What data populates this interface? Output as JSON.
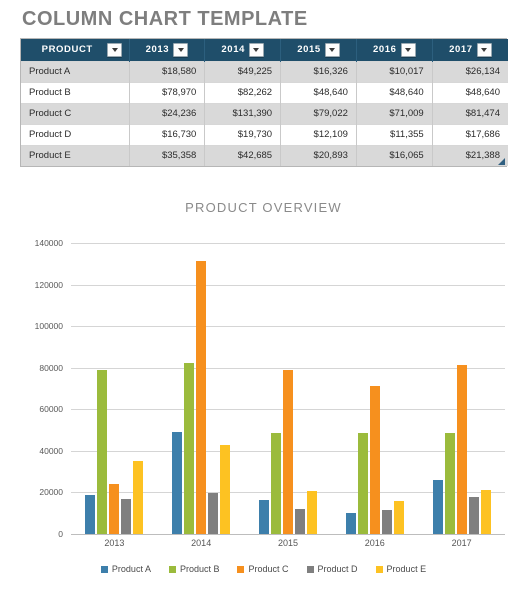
{
  "page_title": "COLUMN CHART TEMPLATE",
  "table": {
    "columns": [
      {
        "label": "PRODUCT",
        "filter_icon": "chevron-down-icon"
      },
      {
        "label": "2013",
        "filter_icon": "chevron-down-icon"
      },
      {
        "label": "2014",
        "filter_icon": "chevron-down-icon"
      },
      {
        "label": "2015",
        "filter_icon": "chevron-down-icon"
      },
      {
        "label": "2016",
        "filter_icon": "chevron-down-icon"
      },
      {
        "label": "2017",
        "filter_icon": "chevron-down-icon"
      }
    ],
    "rows": [
      {
        "product": "Product A",
        "values": [
          "$18,580",
          "$49,225",
          "$16,326",
          "$10,017",
          "$26,134"
        ]
      },
      {
        "product": "Product B",
        "values": [
          "$78,970",
          "$82,262",
          "$48,640",
          "$48,640",
          "$48,640"
        ]
      },
      {
        "product": "Product C",
        "values": [
          "$24,236",
          "$131,390",
          "$79,022",
          "$71,009",
          "$81,474"
        ]
      },
      {
        "product": "Product D",
        "values": [
          "$16,730",
          "$19,730",
          "$12,109",
          "$11,355",
          "$17,686"
        ]
      },
      {
        "product": "Product E",
        "values": [
          "$35,358",
          "$42,685",
          "$20,893",
          "$16,065",
          "$21,388"
        ]
      }
    ],
    "header_bg": "#1f4e6a",
    "stripe_bg": "#d9d9d9"
  },
  "chart_data": {
    "type": "bar",
    "title": "PRODUCT OVERVIEW",
    "xlabel": "",
    "ylabel": "",
    "categories": [
      "2013",
      "2014",
      "2015",
      "2016",
      "2017"
    ],
    "ylim": [
      0,
      140000
    ],
    "yticks": [
      0,
      20000,
      40000,
      60000,
      80000,
      100000,
      120000,
      140000
    ],
    "ytick_labels": [
      "0",
      "20000",
      "40000",
      "60000",
      "80000",
      "100000",
      "120000",
      "140000"
    ],
    "grid": true,
    "legend_position": "bottom",
    "series": [
      {
        "name": "Product A",
        "color": "#3d7fab",
        "values": [
          18580,
          49225,
          16326,
          10017,
          26134
        ]
      },
      {
        "name": "Product B",
        "color": "#9bbb3c",
        "values": [
          78970,
          82262,
          48640,
          48640,
          48640
        ]
      },
      {
        "name": "Product C",
        "color": "#f6901e",
        "values": [
          24236,
          131390,
          79022,
          71009,
          81474
        ]
      },
      {
        "name": "Product D",
        "color": "#7f7f7f",
        "values": [
          16730,
          19730,
          12109,
          11355,
          17686
        ]
      },
      {
        "name": "Product E",
        "color": "#fdc222",
        "values": [
          35358,
          42685,
          20893,
          16065,
          21388
        ]
      }
    ]
  }
}
